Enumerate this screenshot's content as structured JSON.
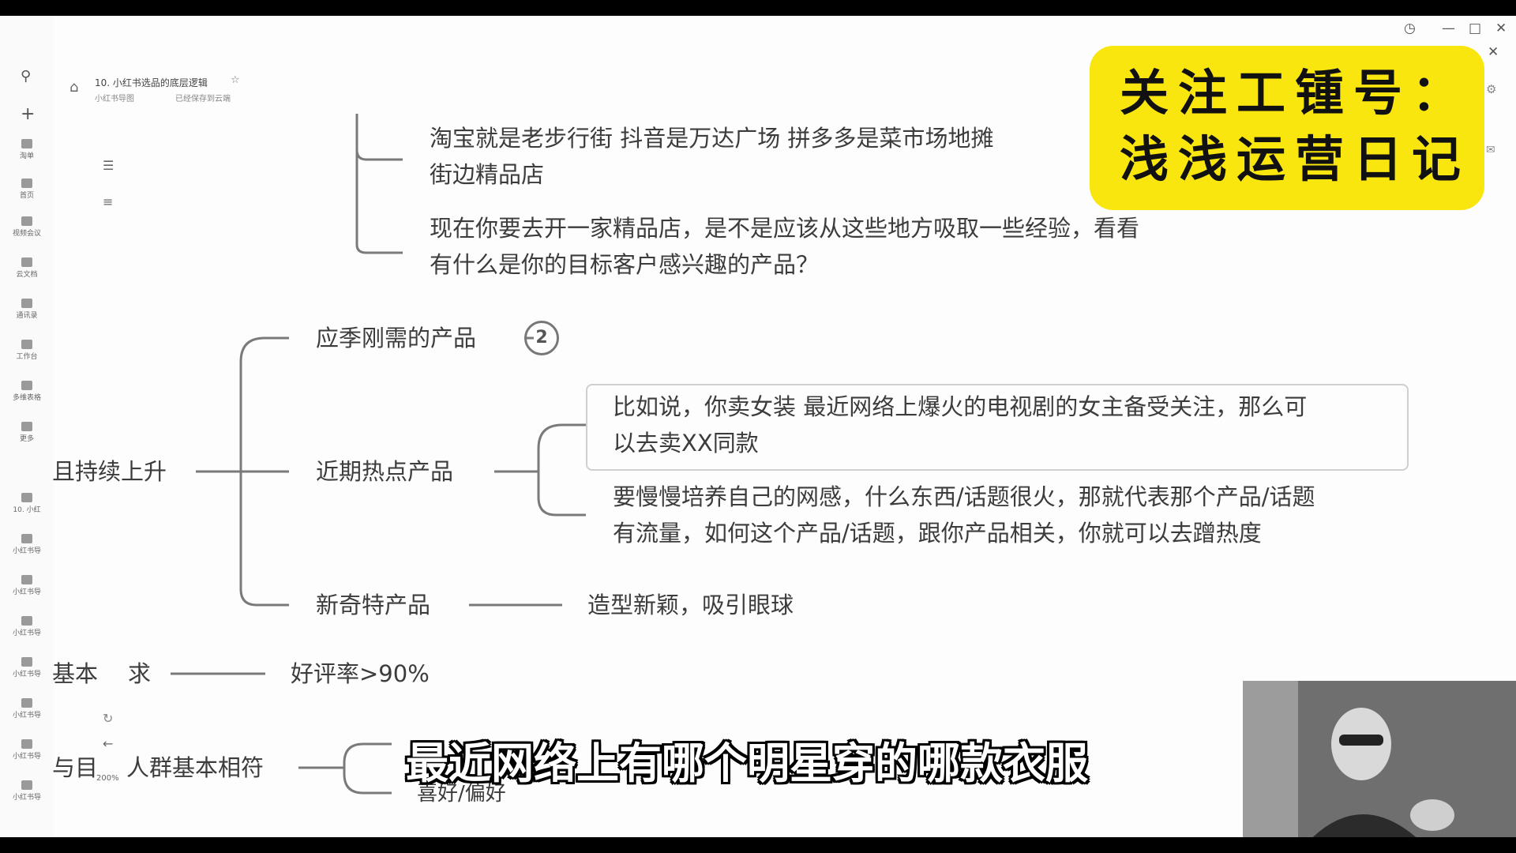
{
  "document": {
    "title": "10. 小红书选品的底层逻辑",
    "breadcrumb": "小红书导图",
    "save_status": "已经保存到云端"
  },
  "sidebar": {
    "items": [
      "淘单",
      "首页",
      "视频会议",
      "云文档",
      "通讯录",
      "工作台",
      "多维表格",
      "更多",
      "10. 小红",
      "小红书导",
      "小红书导",
      "小红书导",
      "小红书导",
      "小红书导",
      "小红书导",
      "小红书导"
    ]
  },
  "toolbar": {
    "zoom": "200%"
  },
  "banner": {
    "line1": "关注工锺号：",
    "line2": "浅浅运营日记"
  },
  "mindmap": {
    "top_line1": "淘宝就是老步行街    抖音是万达广场    拼多多是菜市场地摊",
    "top_line2": "街边精品店",
    "top_line3": "现在你要去开一家精品店，是不是应该从这些地方吸取一些经验，看看",
    "top_line4": "有什么是你的目标客户感兴趣的产品？",
    "node_left": "且持续上升",
    "node_seasonal": "应季刚需的产品",
    "node_seasonal_badge": "2",
    "node_hot": "近期热点产品",
    "hot_detail1_line1": "比如说，你卖女装 最近网络上爆火的电视剧的女主备受关注，那么可",
    "hot_detail1_line2": "以去卖XX同款",
    "hot_detail2_line1": "要慢慢培养自己的网感，什么东西/话题很火，那就代表那个产品/话题",
    "hot_detail2_line2": "有流量，如何这个产品/话题，跟你产品相关，你就可以去蹭热度",
    "node_novel": "新奇特产品",
    "novel_detail": "造型新颖，吸引眼球",
    "node_basic": "基本",
    "node_basic_tail": "求",
    "basic_detail": "好评率>90%",
    "node_crowd_left": "与目",
    "node_crowd": "人群基本相符",
    "crowd_detail": "喜好/偏好"
  },
  "subtitle": "最近网络上有哪个明星穿的哪款衣服"
}
